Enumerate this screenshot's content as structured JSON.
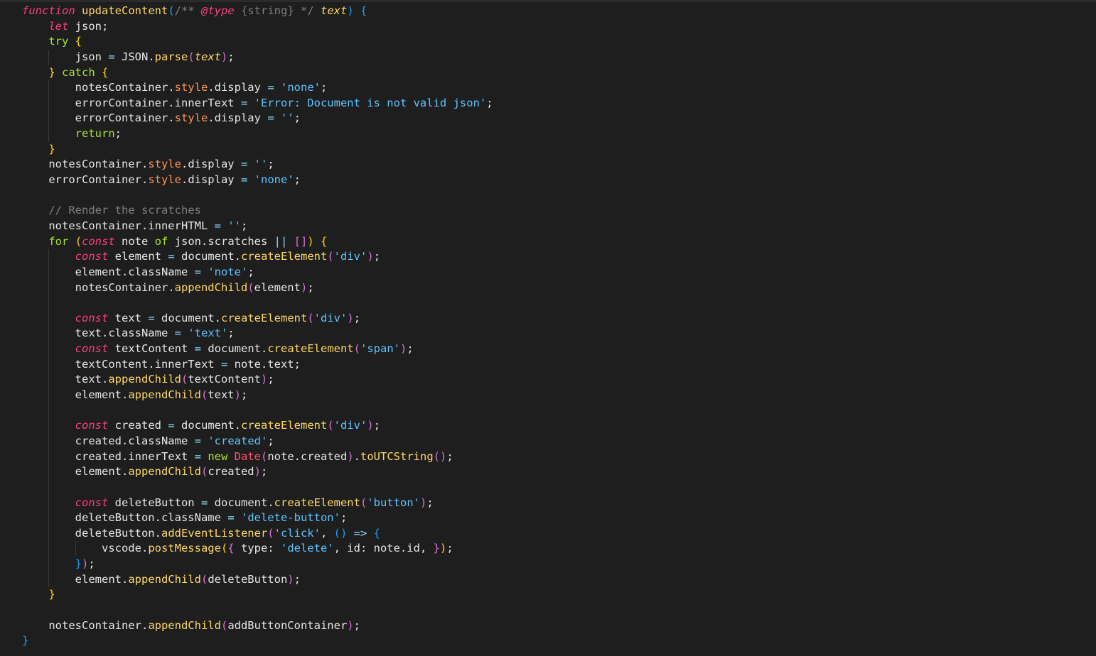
{
  "editor": {
    "language": "javascript",
    "lines": [
      {
        "indent": 0,
        "tokens": [
          [
            "kw-it",
            "function"
          ],
          [
            "txt",
            " "
          ],
          [
            "fn",
            "updateContent"
          ],
          [
            "b3",
            "("
          ],
          [
            "cm",
            "/** "
          ],
          [
            "cm-tag",
            "@type"
          ],
          [
            "cm",
            " {string} */"
          ],
          [
            "txt",
            " "
          ],
          [
            "param",
            "text"
          ],
          [
            "b3",
            ")"
          ],
          [
            "txt",
            " "
          ],
          [
            "b3",
            "{"
          ]
        ]
      },
      {
        "indent": 1,
        "tokens": [
          [
            "kw-it",
            "let"
          ],
          [
            "txt",
            " json;"
          ]
        ]
      },
      {
        "indent": 1,
        "tokens": [
          [
            "kw",
            "try"
          ],
          [
            "txt",
            " "
          ],
          [
            "b1",
            "{"
          ]
        ]
      },
      {
        "indent": 2,
        "tokens": [
          [
            "txt",
            "json "
          ],
          [
            "op",
            "="
          ],
          [
            "txt",
            " JSON."
          ],
          [
            "fn",
            "parse"
          ],
          [
            "b2",
            "("
          ],
          [
            "param",
            "text"
          ],
          [
            "b2",
            ")"
          ],
          [
            "txt",
            ";"
          ]
        ]
      },
      {
        "indent": 1,
        "tokens": [
          [
            "b1",
            "}"
          ],
          [
            "txt",
            " "
          ],
          [
            "kw",
            "catch"
          ],
          [
            "txt",
            " "
          ],
          [
            "b1",
            "{"
          ]
        ]
      },
      {
        "indent": 2,
        "tokens": [
          [
            "txt",
            "notesContainer."
          ],
          [
            "prop",
            "style"
          ],
          [
            "txt",
            ".display "
          ],
          [
            "op",
            "="
          ],
          [
            "txt",
            " "
          ],
          [
            "str",
            "'none'"
          ],
          [
            "txt",
            ";"
          ]
        ]
      },
      {
        "indent": 2,
        "tokens": [
          [
            "txt",
            "errorContainer.innerText "
          ],
          [
            "op",
            "="
          ],
          [
            "txt",
            " "
          ],
          [
            "str",
            "'Error: Document is not valid json'"
          ],
          [
            "txt",
            ";"
          ]
        ]
      },
      {
        "indent": 2,
        "tokens": [
          [
            "txt",
            "errorContainer."
          ],
          [
            "prop",
            "style"
          ],
          [
            "txt",
            ".display "
          ],
          [
            "op",
            "="
          ],
          [
            "txt",
            " "
          ],
          [
            "str",
            "''"
          ],
          [
            "txt",
            ";"
          ]
        ]
      },
      {
        "indent": 2,
        "tokens": [
          [
            "kw",
            "return"
          ],
          [
            "txt",
            ";"
          ]
        ]
      },
      {
        "indent": 1,
        "tokens": [
          [
            "b1",
            "}"
          ]
        ]
      },
      {
        "indent": 1,
        "tokens": [
          [
            "txt",
            "notesContainer."
          ],
          [
            "prop",
            "style"
          ],
          [
            "txt",
            ".display "
          ],
          [
            "op",
            "="
          ],
          [
            "txt",
            " "
          ],
          [
            "str",
            "''"
          ],
          [
            "txt",
            ";"
          ]
        ]
      },
      {
        "indent": 1,
        "tokens": [
          [
            "txt",
            "errorContainer."
          ],
          [
            "prop",
            "style"
          ],
          [
            "txt",
            ".display "
          ],
          [
            "op",
            "="
          ],
          [
            "txt",
            " "
          ],
          [
            "str",
            "'none'"
          ],
          [
            "txt",
            ";"
          ]
        ]
      },
      {
        "indent": 1,
        "tokens": []
      },
      {
        "indent": 1,
        "tokens": [
          [
            "cm",
            "// Render the scratches"
          ]
        ]
      },
      {
        "indent": 1,
        "tokens": [
          [
            "txt",
            "notesContainer.innerHTML "
          ],
          [
            "op",
            "="
          ],
          [
            "txt",
            " "
          ],
          [
            "str",
            "''"
          ],
          [
            "txt",
            ";"
          ]
        ]
      },
      {
        "indent": 1,
        "tokens": [
          [
            "kw",
            "for"
          ],
          [
            "txt",
            " "
          ],
          [
            "b1",
            "("
          ],
          [
            "kw-it",
            "const"
          ],
          [
            "txt",
            " note "
          ],
          [
            "kw",
            "of"
          ],
          [
            "txt",
            " json.scratches "
          ],
          [
            "op",
            "||"
          ],
          [
            "txt",
            " "
          ],
          [
            "b2",
            "[]"
          ],
          [
            "b1",
            ")"
          ],
          [
            "txt",
            " "
          ],
          [
            "b1",
            "{"
          ]
        ]
      },
      {
        "indent": 2,
        "tokens": [
          [
            "kw-it",
            "const"
          ],
          [
            "txt",
            " element "
          ],
          [
            "op",
            "="
          ],
          [
            "txt",
            " document."
          ],
          [
            "fn",
            "createElement"
          ],
          [
            "b2",
            "("
          ],
          [
            "str",
            "'div'"
          ],
          [
            "b2",
            ")"
          ],
          [
            "txt",
            ";"
          ]
        ]
      },
      {
        "indent": 2,
        "tokens": [
          [
            "txt",
            "element.className "
          ],
          [
            "op",
            "="
          ],
          [
            "txt",
            " "
          ],
          [
            "str",
            "'note'"
          ],
          [
            "txt",
            ";"
          ]
        ]
      },
      {
        "indent": 2,
        "tokens": [
          [
            "txt",
            "notesContainer."
          ],
          [
            "fn",
            "appendChild"
          ],
          [
            "b2",
            "("
          ],
          [
            "txt",
            "element"
          ],
          [
            "b2",
            ")"
          ],
          [
            "txt",
            ";"
          ]
        ]
      },
      {
        "indent": 2,
        "tokens": []
      },
      {
        "indent": 2,
        "tokens": [
          [
            "kw-it",
            "const"
          ],
          [
            "txt",
            " text "
          ],
          [
            "op",
            "="
          ],
          [
            "txt",
            " document."
          ],
          [
            "fn",
            "createElement"
          ],
          [
            "b2",
            "("
          ],
          [
            "str",
            "'div'"
          ],
          [
            "b2",
            ")"
          ],
          [
            "txt",
            ";"
          ]
        ]
      },
      {
        "indent": 2,
        "tokens": [
          [
            "txt",
            "text.className "
          ],
          [
            "op",
            "="
          ],
          [
            "txt",
            " "
          ],
          [
            "str",
            "'text'"
          ],
          [
            "txt",
            ";"
          ]
        ]
      },
      {
        "indent": 2,
        "tokens": [
          [
            "kw-it",
            "const"
          ],
          [
            "txt",
            " textContent "
          ],
          [
            "op",
            "="
          ],
          [
            "txt",
            " document."
          ],
          [
            "fn",
            "createElement"
          ],
          [
            "b2",
            "("
          ],
          [
            "str",
            "'span'"
          ],
          [
            "b2",
            ")"
          ],
          [
            "txt",
            ";"
          ]
        ]
      },
      {
        "indent": 2,
        "tokens": [
          [
            "txt",
            "textContent.innerText "
          ],
          [
            "op",
            "="
          ],
          [
            "txt",
            " note.text;"
          ]
        ]
      },
      {
        "indent": 2,
        "tokens": [
          [
            "txt",
            "text."
          ],
          [
            "fn",
            "appendChild"
          ],
          [
            "b2",
            "("
          ],
          [
            "txt",
            "textContent"
          ],
          [
            "b2",
            ")"
          ],
          [
            "txt",
            ";"
          ]
        ]
      },
      {
        "indent": 2,
        "tokens": [
          [
            "txt",
            "element."
          ],
          [
            "fn",
            "appendChild"
          ],
          [
            "b2",
            "("
          ],
          [
            "txt",
            "text"
          ],
          [
            "b2",
            ")"
          ],
          [
            "txt",
            ";"
          ]
        ]
      },
      {
        "indent": 2,
        "tokens": []
      },
      {
        "indent": 2,
        "tokens": [
          [
            "kw-it",
            "const"
          ],
          [
            "txt",
            " created "
          ],
          [
            "op",
            "="
          ],
          [
            "txt",
            " document."
          ],
          [
            "fn",
            "createElement"
          ],
          [
            "b2",
            "("
          ],
          [
            "str",
            "'div'"
          ],
          [
            "b2",
            ")"
          ],
          [
            "txt",
            ";"
          ]
        ]
      },
      {
        "indent": 2,
        "tokens": [
          [
            "txt",
            "created.className "
          ],
          [
            "op",
            "="
          ],
          [
            "txt",
            " "
          ],
          [
            "str",
            "'created'"
          ],
          [
            "txt",
            ";"
          ]
        ]
      },
      {
        "indent": 2,
        "tokens": [
          [
            "txt",
            "created.innerText "
          ],
          [
            "op",
            "="
          ],
          [
            "txt",
            " "
          ],
          [
            "kw",
            "new"
          ],
          [
            "txt",
            " "
          ],
          [
            "cls",
            "Date"
          ],
          [
            "b2",
            "("
          ],
          [
            "txt",
            "note.created"
          ],
          [
            "b2",
            ")"
          ],
          [
            "txt",
            "."
          ],
          [
            "fn",
            "toUTCString"
          ],
          [
            "b2",
            "()"
          ],
          [
            "txt",
            ";"
          ]
        ]
      },
      {
        "indent": 2,
        "tokens": [
          [
            "txt",
            "element."
          ],
          [
            "fn",
            "appendChild"
          ],
          [
            "b2",
            "("
          ],
          [
            "txt",
            "created"
          ],
          [
            "b2",
            ")"
          ],
          [
            "txt",
            ";"
          ]
        ]
      },
      {
        "indent": 2,
        "tokens": []
      },
      {
        "indent": 2,
        "tokens": [
          [
            "kw-it",
            "const"
          ],
          [
            "txt",
            " deleteButton "
          ],
          [
            "op",
            "="
          ],
          [
            "txt",
            " document."
          ],
          [
            "fn",
            "createElement"
          ],
          [
            "b2",
            "("
          ],
          [
            "str",
            "'button'"
          ],
          [
            "b2",
            ")"
          ],
          [
            "txt",
            ";"
          ]
        ]
      },
      {
        "indent": 2,
        "tokens": [
          [
            "txt",
            "deleteButton.className "
          ],
          [
            "op",
            "="
          ],
          [
            "txt",
            " "
          ],
          [
            "str",
            "'delete-button'"
          ],
          [
            "txt",
            ";"
          ]
        ]
      },
      {
        "indent": 2,
        "tokens": [
          [
            "txt",
            "deleteButton."
          ],
          [
            "fn",
            "addEventListener"
          ],
          [
            "b2",
            "("
          ],
          [
            "str",
            "'click'"
          ],
          [
            "txt",
            ", "
          ],
          [
            "b3",
            "()"
          ],
          [
            "txt",
            " "
          ],
          [
            "op",
            "=>"
          ],
          [
            "txt",
            " "
          ],
          [
            "b3",
            "{"
          ]
        ]
      },
      {
        "indent": 3,
        "tokens": [
          [
            "txt",
            "vscode."
          ],
          [
            "fn",
            "postMessage"
          ],
          [
            "b1",
            "("
          ],
          [
            "b2",
            "{"
          ],
          [
            "txt",
            " type: "
          ],
          [
            "str",
            "'delete'"
          ],
          [
            "txt",
            ", id: note.id, "
          ],
          [
            "b2",
            "}"
          ],
          [
            "b1",
            ")"
          ],
          [
            "txt",
            ";"
          ]
        ]
      },
      {
        "indent": 2,
        "tokens": [
          [
            "b3",
            "}"
          ],
          [
            "b2",
            ")"
          ],
          [
            "txt",
            ";"
          ]
        ]
      },
      {
        "indent": 2,
        "tokens": [
          [
            "txt",
            "element."
          ],
          [
            "fn",
            "appendChild"
          ],
          [
            "b2",
            "("
          ],
          [
            "txt",
            "deleteButton"
          ],
          [
            "b2",
            ")"
          ],
          [
            "txt",
            ";"
          ]
        ]
      },
      {
        "indent": 1,
        "tokens": [
          [
            "b1",
            "}"
          ]
        ]
      },
      {
        "indent": 1,
        "tokens": []
      },
      {
        "indent": 1,
        "tokens": [
          [
            "txt",
            "notesContainer."
          ],
          [
            "fn",
            "appendChild"
          ],
          [
            "b2",
            "("
          ],
          [
            "txt",
            "addButtonContainer"
          ],
          [
            "b2",
            ")"
          ],
          [
            "txt",
            ";"
          ]
        ]
      },
      {
        "indent": 0,
        "tokens": [
          [
            "b3",
            "}"
          ]
        ]
      }
    ]
  }
}
